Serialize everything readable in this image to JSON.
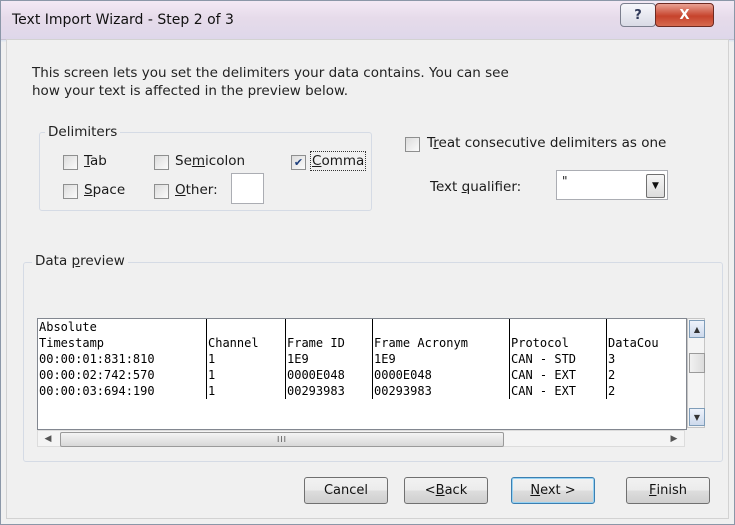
{
  "window": {
    "title": "Text Import Wizard - Step 2 of 3",
    "help_icon": "help-icon",
    "help_glyph": "?",
    "close_icon": "close-icon",
    "close_glyph": "X"
  },
  "description": {
    "line1": "This screen lets you set the delimiters your data contains.  You can see",
    "line2": "how your text is affected in the preview below."
  },
  "delimiters": {
    "group_label": "Delimiters",
    "tab": {
      "prefix": "",
      "mnemonic": "T",
      "suffix": "ab",
      "checked": false
    },
    "semicolon": {
      "prefix": "Se",
      "mnemonic": "m",
      "suffix": "icolon",
      "checked": false
    },
    "comma": {
      "prefix": "",
      "mnemonic": "C",
      "suffix": "omma",
      "checked": true
    },
    "space": {
      "prefix": "",
      "mnemonic": "S",
      "suffix": "pace",
      "checked": false
    },
    "other": {
      "prefix": "",
      "mnemonic": "O",
      "suffix": "ther:",
      "checked": false,
      "value": ""
    }
  },
  "consecutive": {
    "prefix": "T",
    "mnemonic": "r",
    "suffix": "eat consecutive delimiters as one",
    "checked": false
  },
  "text_qualifier": {
    "prefix": "Text ",
    "mnemonic": "q",
    "suffix": "ualifier:",
    "value": "\""
  },
  "data_preview": {
    "group_prefix": "Data ",
    "group_mnemonic": "p",
    "group_suffix": "review",
    "header_line1": [
      "Absolute",
      "",
      "",
      "",
      "",
      ""
    ],
    "header_line2": [
      "Timestamp",
      "Channel",
      "Frame ID",
      "Frame Acronym",
      "Protocol",
      "DataCou"
    ],
    "rows": [
      [
        "00:00:01:831:810",
        "1",
        "1E9",
        "1E9",
        "CAN - STD",
        "3"
      ],
      [
        "00:00:02:742:570",
        "1",
        "0000E048",
        "0000E048",
        "CAN - EXT",
        "2"
      ],
      [
        "00:00:03:694:190",
        "1",
        "00293983",
        "00293983",
        "CAN - EXT",
        "2"
      ]
    ],
    "hscroll_grip": "III"
  },
  "buttons": {
    "cancel": {
      "prefix": "Cancel",
      "mnemonic": "",
      "suffix": ""
    },
    "back": {
      "prefix": "< ",
      "mnemonic": "B",
      "suffix": "ack"
    },
    "next": {
      "prefix": "",
      "mnemonic": "N",
      "suffix": "ext >"
    },
    "finish": {
      "prefix": "",
      "mnemonic": "F",
      "suffix": "inish"
    }
  }
}
